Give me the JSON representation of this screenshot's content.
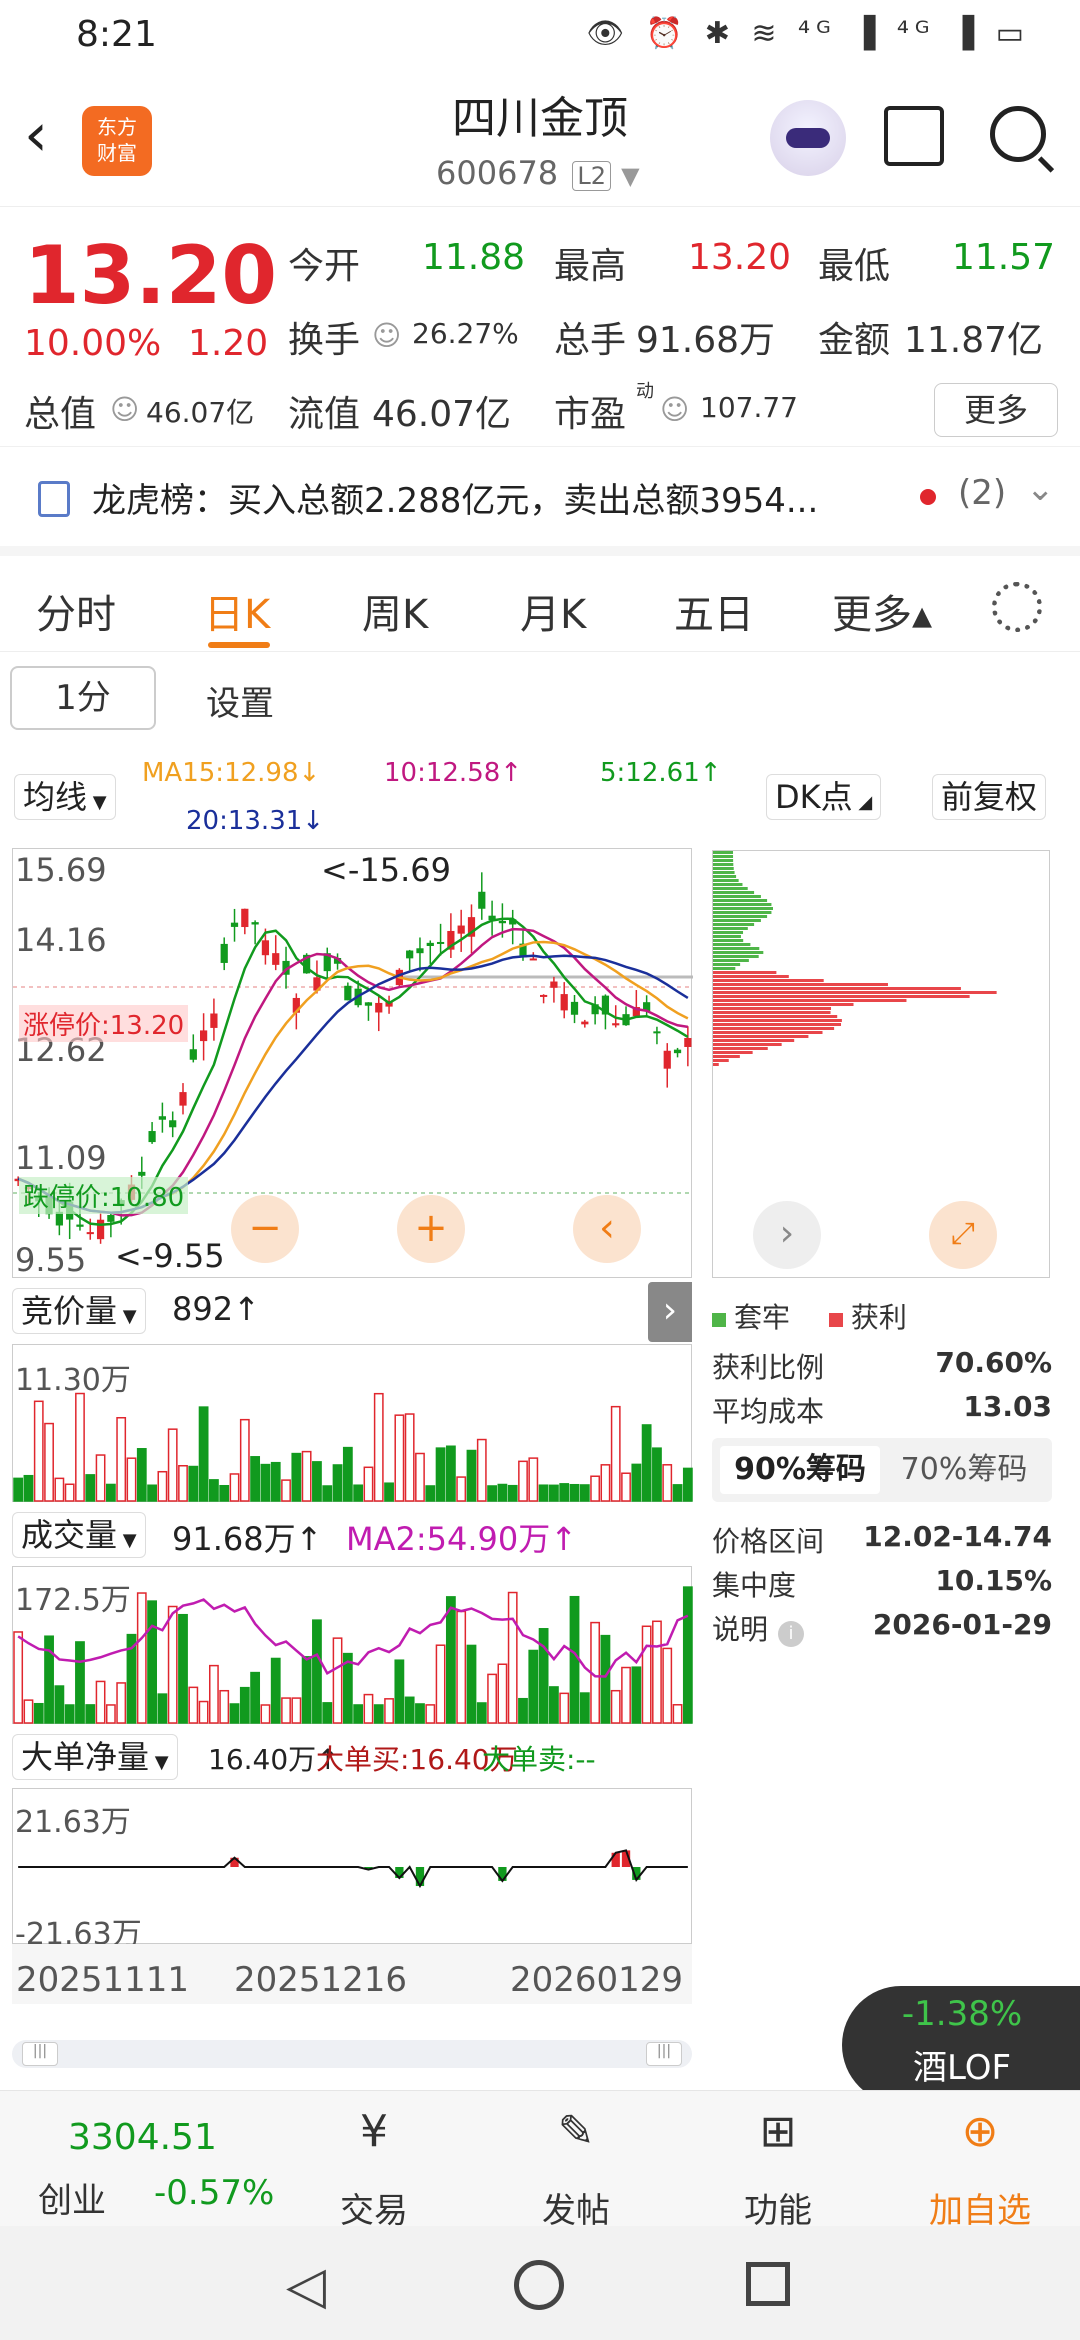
{
  "status_bar": {
    "time": "8:21",
    "icons": "👁 ⏰ ✱ ≋ ⁴ᴳ ▐ ⁴ᴳ ▐ ▭"
  },
  "header": {
    "name": "四川金顶",
    "code": "600678",
    "level": "L2",
    "brand_line1": "东方",
    "brand_line2": "财富"
  },
  "quote": {
    "price": "13.20",
    "change_pct": "10.00%",
    "change": "1.20",
    "open_label": "今开",
    "open": "11.88",
    "high_label": "最高",
    "high": "13.20",
    "low_label": "最低",
    "low": "11.57",
    "turnover_label": "换手",
    "turnover": "26.27%",
    "volume_label": "总手",
    "volume": "91.68万",
    "amount_label": "金额",
    "amount": "11.87亿",
    "mktcap_label": "总值",
    "mktcap": "46.07亿",
    "float_label": "流值",
    "float": "46.07亿",
    "pe_label": "市盈",
    "pe_sup": "动",
    "pe": "107.77",
    "more": "更多"
  },
  "dragon_tiger": {
    "text": "龙虎榜：买入总额2.288亿元，卖出总额3954...",
    "count": "(2)"
  },
  "tabs": [
    "分时",
    "日K",
    "周K",
    "月K",
    "五日",
    "更多▴"
  ],
  "toolbar": {
    "interval": "1分",
    "settings": "设置"
  },
  "ma_bar": {
    "selector": "均线",
    "ma15": "MA15:12.98↓",
    "ma10": "10:12.58↑",
    "ma5": "5:12.61↑",
    "ma20": "20:13.31↓",
    "dk": "DK点",
    "adjust": "前复权"
  },
  "kline": {
    "y_labels": [
      "15.69",
      "14.16",
      "12.62",
      "11.09",
      "9.55"
    ],
    "high_note": "<-15.69",
    "low_note": "<-9.55",
    "limit_up": "涨停价:13.20",
    "limit_down": "跌停价:10.80",
    "limit_colors": {
      "up": "#e0262d",
      "down": "#119a1e"
    }
  },
  "chip_legend": {
    "trapped": "套牢",
    "profit": "获利"
  },
  "chip_info": {
    "profit_ratio_label": "获利比例",
    "profit_ratio": "70.60%",
    "avg_cost_label": "平均成本",
    "avg_cost": "13.03",
    "tab90": "90%筹码",
    "tab70": "70%筹码",
    "range_label": "价格区间",
    "range": "12.02-14.74",
    "concentration_label": "集中度",
    "concentration": "10.15%",
    "note_label": "说明",
    "note_date": "2026-01-29"
  },
  "auction_panel": {
    "selector": "竞价量",
    "value": "892↑",
    "ylabel": "11.30万"
  },
  "volume_panel": {
    "selector": "成交量",
    "value": "91.68万↑",
    "ma2": "MA2:54.90万↑",
    "ylabel": "172.5万"
  },
  "bigorder_panel": {
    "selector": "大单净量",
    "value": "16.40万↑",
    "buy": "大单买:16.40万",
    "sell": "大单卖:--",
    "ytop": "21.63万",
    "ybottom": "-21.63万"
  },
  "x_axis": [
    "20251111",
    "20251216",
    "20260129"
  ],
  "float_card": {
    "pct": "-1.38%",
    "name": "酒LOF"
  },
  "bottom_nav": {
    "index_value": "3304.51",
    "index_name": "创业",
    "index_change": "-0.57%",
    "trade": "交易",
    "post": "发帖",
    "function": "功能",
    "add": "加自选"
  },
  "colors": {
    "up": "#e0262d",
    "down": "#119a1e",
    "accent": "#f07d16"
  }
}
